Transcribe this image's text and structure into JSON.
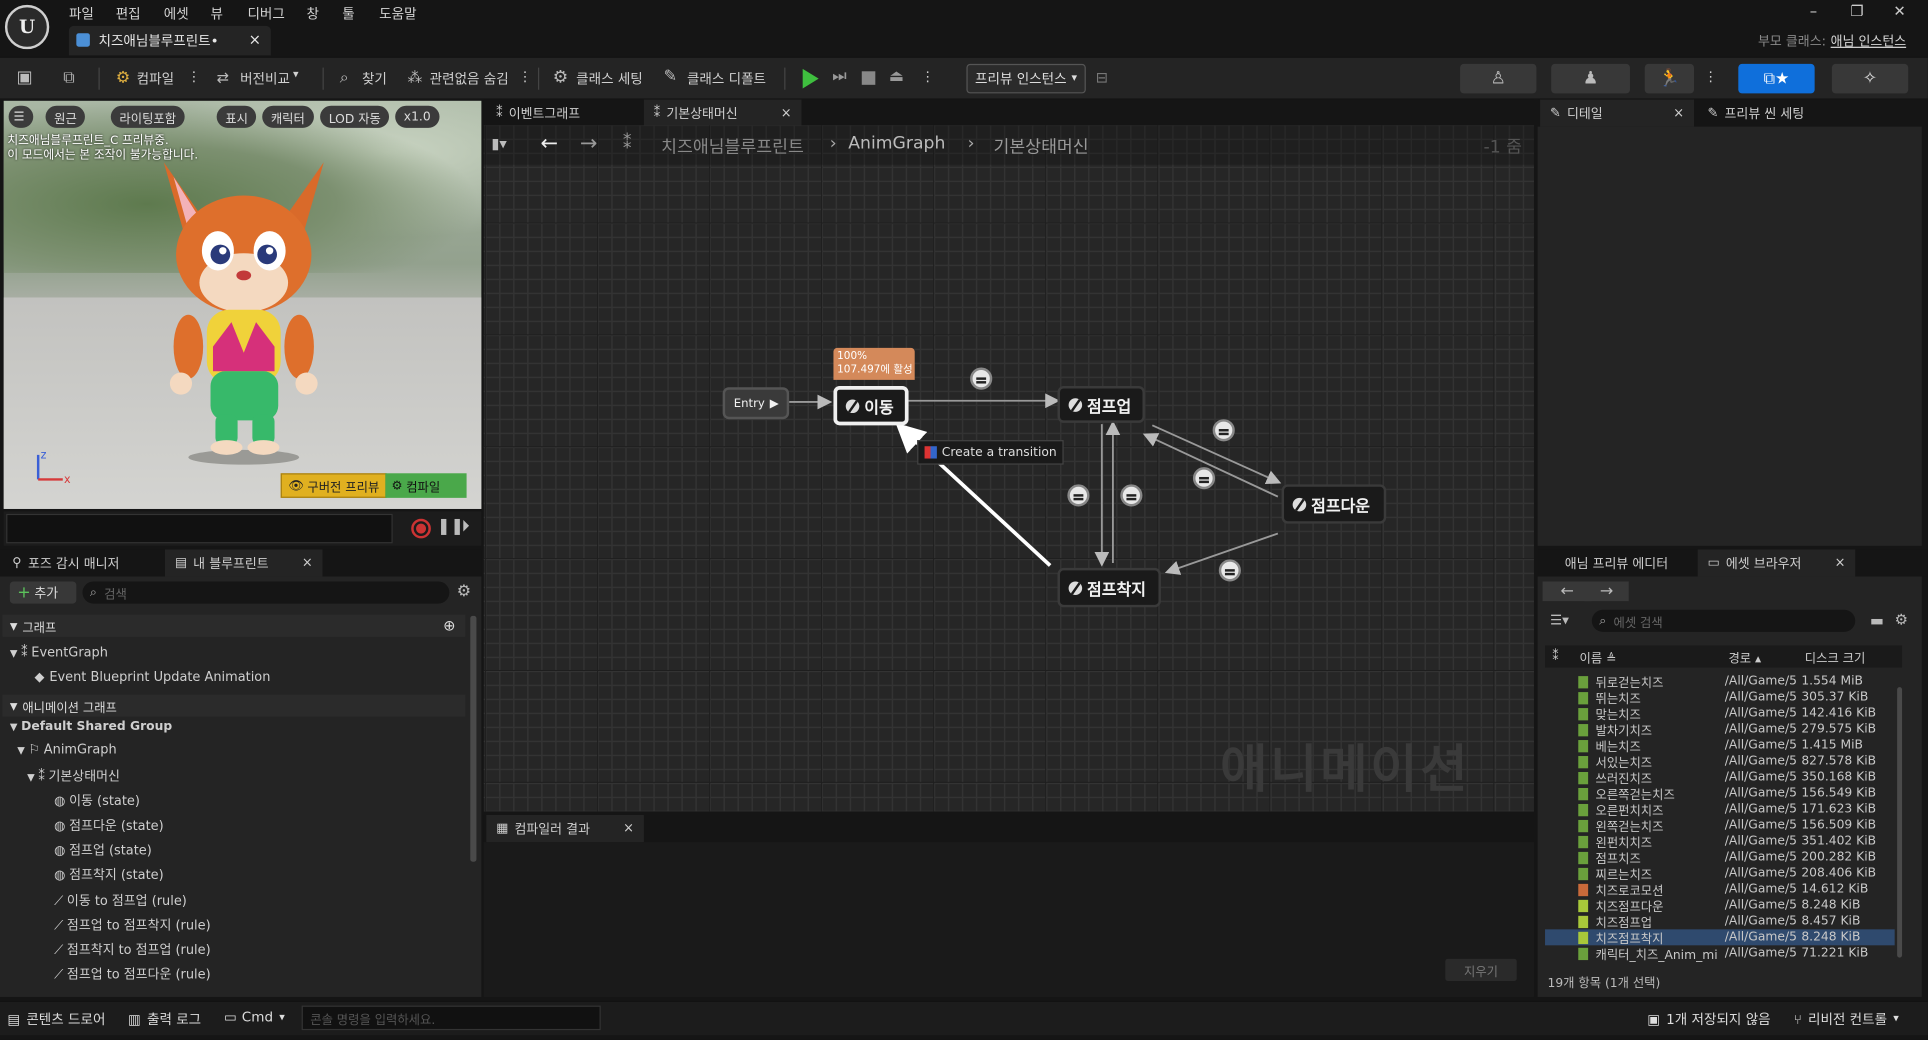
{
  "menubar": {
    "items": [
      "파일",
      "편집",
      "에셋",
      "뷰",
      "디버그",
      "창",
      "툴",
      "도움말"
    ],
    "doc_tab": "치즈애님블루프린트•",
    "parent_class_label": "부모 클래스:",
    "parent_class_value": "애님 인스턴스"
  },
  "toolbar": {
    "compile": "컴파일",
    "diff": "버전비교",
    "find": "찾기",
    "hide_unrelated": "관련없음 숨김",
    "class_settings": "클래스 세팅",
    "class_defaults": "클래스 디폴트",
    "preview_instance": "프리뷰 인스턴스"
  },
  "viewport": {
    "buttons": [
      "원근",
      "라이팅포함",
      "표시",
      "캐릭터",
      "LOD 자동",
      "x1.0"
    ],
    "note1": "치즈애님블루프린트_C 프리뷰중.",
    "note2": "이 모드에서는 본 조작이 불가능합니다.",
    "stale_preview": "구버전 프리뷰",
    "compile_btn": "컴파일",
    "axis_z": "z",
    "axis_x": "x"
  },
  "left_tabs": {
    "pose_watch": "포즈 감시 매니저",
    "my_blueprint": "내 블루프린트"
  },
  "my_blueprint": {
    "add": "추가",
    "search_placeholder": "검색",
    "graphs_header": "그래프",
    "event_graph": "EventGraph",
    "event_update": "Event Blueprint Update Animation",
    "anim_graphs_header": "애니메이션 그래프",
    "default_group": "Default Shared Group",
    "anim_graph": "AnimGraph",
    "state_machine": "기본상태머신",
    "states": [
      "이동 (state)",
      "점프다운 (state)",
      "점프업 (state)",
      "점프착지 (state)"
    ],
    "rules": [
      "이동 to 점프업 (rule)",
      "점프업 to 점프착지 (rule)",
      "점프착지 to 점프업 (rule)",
      "점프업 to 점프다운 (rule)"
    ]
  },
  "graph_tabs": {
    "event_graph": "이벤트그래프",
    "state_machine": "기본상태머신"
  },
  "breadcrumb": {
    "root": "치즈애님블루프린트",
    "mid": "AnimGraph",
    "leaf": "기본상태머신",
    "zoom": "-1 줌"
  },
  "graph": {
    "entry": "Entry",
    "state_move": "이동",
    "state_jump_up": "점프업",
    "state_jump_down": "점프다운",
    "state_jump_land": "점프착지",
    "tooltip_line1": "100%",
    "tooltip_line2": "107.497에 활성",
    "create_transition": "Create a transition",
    "watermark": "애니메이션"
  },
  "compiler": {
    "tab": "컴파일러 결과",
    "clear": "지우기"
  },
  "right_tabs": {
    "details": "디테일",
    "preview_scene": "프리뷰 씬 세팅"
  },
  "bottom_right_tabs": {
    "anim_preview": "애님 프리뷰 에디터",
    "asset_browser": "에셋 브라우저"
  },
  "asset_browser": {
    "search_placeholder": "에셋 검색",
    "col_name": "이름",
    "col_path": "경로",
    "col_size": "디스크 크기",
    "footer": "19개 항목 (1개 선택)",
    "rows": [
      {
        "name": "뒤로걷는치즈",
        "path": "/All/Game/5",
        "size": "1.554 MiB"
      },
      {
        "name": "뛰는치즈",
        "path": "/All/Game/5",
        "size": "305.37 KiB"
      },
      {
        "name": "맞는치즈",
        "path": "/All/Game/5",
        "size": "142.416 KiB"
      },
      {
        "name": "발차기치즈",
        "path": "/All/Game/5",
        "size": "279.575 KiB"
      },
      {
        "name": "베는치즈",
        "path": "/All/Game/5",
        "size": "1.415 MiB"
      },
      {
        "name": "서있는치즈",
        "path": "/All/Game/5",
        "size": "827.578 KiB"
      },
      {
        "name": "쓰러진치즈",
        "path": "/All/Game/5",
        "size": "350.168 KiB"
      },
      {
        "name": "오른쪽걷는치즈",
        "path": "/All/Game/5",
        "size": "156.549 KiB"
      },
      {
        "name": "오른펀치치즈",
        "path": "/All/Game/5",
        "size": "171.623 KiB"
      },
      {
        "name": "왼쪽걷는치즈",
        "path": "/All/Game/5",
        "size": "156.509 KiB"
      },
      {
        "name": "왼펀치치즈",
        "path": "/All/Game/5",
        "size": "351.402 KiB"
      },
      {
        "name": "점프치즈",
        "path": "/All/Game/5",
        "size": "200.282 KiB"
      },
      {
        "name": "찌르는치즈",
        "path": "/All/Game/5",
        "size": "208.406 KiB"
      },
      {
        "name": "치즈로코모션",
        "path": "/All/Game/5",
        "size": "14.612 KiB"
      },
      {
        "name": "치즈점프다운",
        "path": "/All/Game/5",
        "size": "8.248 KiB"
      },
      {
        "name": "치즈점프업",
        "path": "/All/Game/5",
        "size": "8.457 KiB"
      },
      {
        "name": "치즈점프착지",
        "path": "/All/Game/5",
        "size": "8.248 KiB"
      },
      {
        "name": "캐릭터_치즈_Anim_mi",
        "path": "/All/Game/5",
        "size": "71.221 KiB"
      }
    ]
  },
  "statusbar": {
    "content_drawer": "콘텐츠 드로어",
    "output_log": "출력 로그",
    "cmd": "Cmd",
    "console_placeholder": "콘솔 명령을 입력하세요.",
    "unsaved": "1개 저장되지 않음",
    "revision": "리비전 컨트롤"
  },
  "colors": {
    "accent_blue": "#0f6fdb",
    "play_green": "#3fbf3f",
    "node_tooltip": "#d4895a",
    "selected_row": "#2f4a6e"
  }
}
